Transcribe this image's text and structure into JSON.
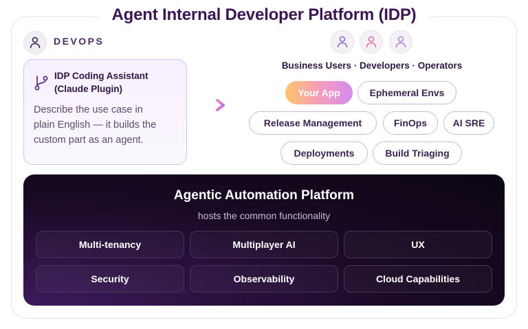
{
  "title": "Agent Internal Developer Platform (IDP)",
  "devops": {
    "label": "DEVOPS",
    "avatar_icon": "person-icon",
    "assistant": {
      "icon": "git-branch-icon",
      "title_line1": "IDP Coding Assistant",
      "title_line2": "(Claude Plugin)",
      "desc_line1": "Describe the use case in",
      "desc_line2": "plain English — it builds the",
      "desc_line3": "custom part as an agent."
    }
  },
  "arrow_icon": "chevron-right-icon",
  "users": {
    "caption": "Business Users · Developers · Operators",
    "avatar_colors": [
      "#8a6cd0",
      "#e2709e",
      "#a48ad0"
    ]
  },
  "apps": [
    {
      "label": "Your App",
      "highlight": true
    },
    {
      "label": "Ephemeral Envs"
    },
    {
      "label": "Release Management"
    },
    {
      "label": "FinOps"
    },
    {
      "label": "AI SRE"
    },
    {
      "label": "Deployments"
    },
    {
      "label": "Build Triaging"
    }
  ],
  "platform": {
    "title": "Agentic Automation Platform",
    "subtitle": "hosts the common functionality",
    "tiles": [
      "Multi-tenancy",
      "Multiplayer AI",
      "UX",
      "Security",
      "Observability",
      "Cloud Capabilities"
    ]
  },
  "colors": {
    "accent_purple": "#3a1653",
    "card_border": "#d6c0ef",
    "arrow_gradient": [
      "#f08ab6",
      "#b46fe8"
    ],
    "highlight_gradient": [
      "#ffc46a",
      "#f49ac2",
      "#d48bee"
    ]
  }
}
